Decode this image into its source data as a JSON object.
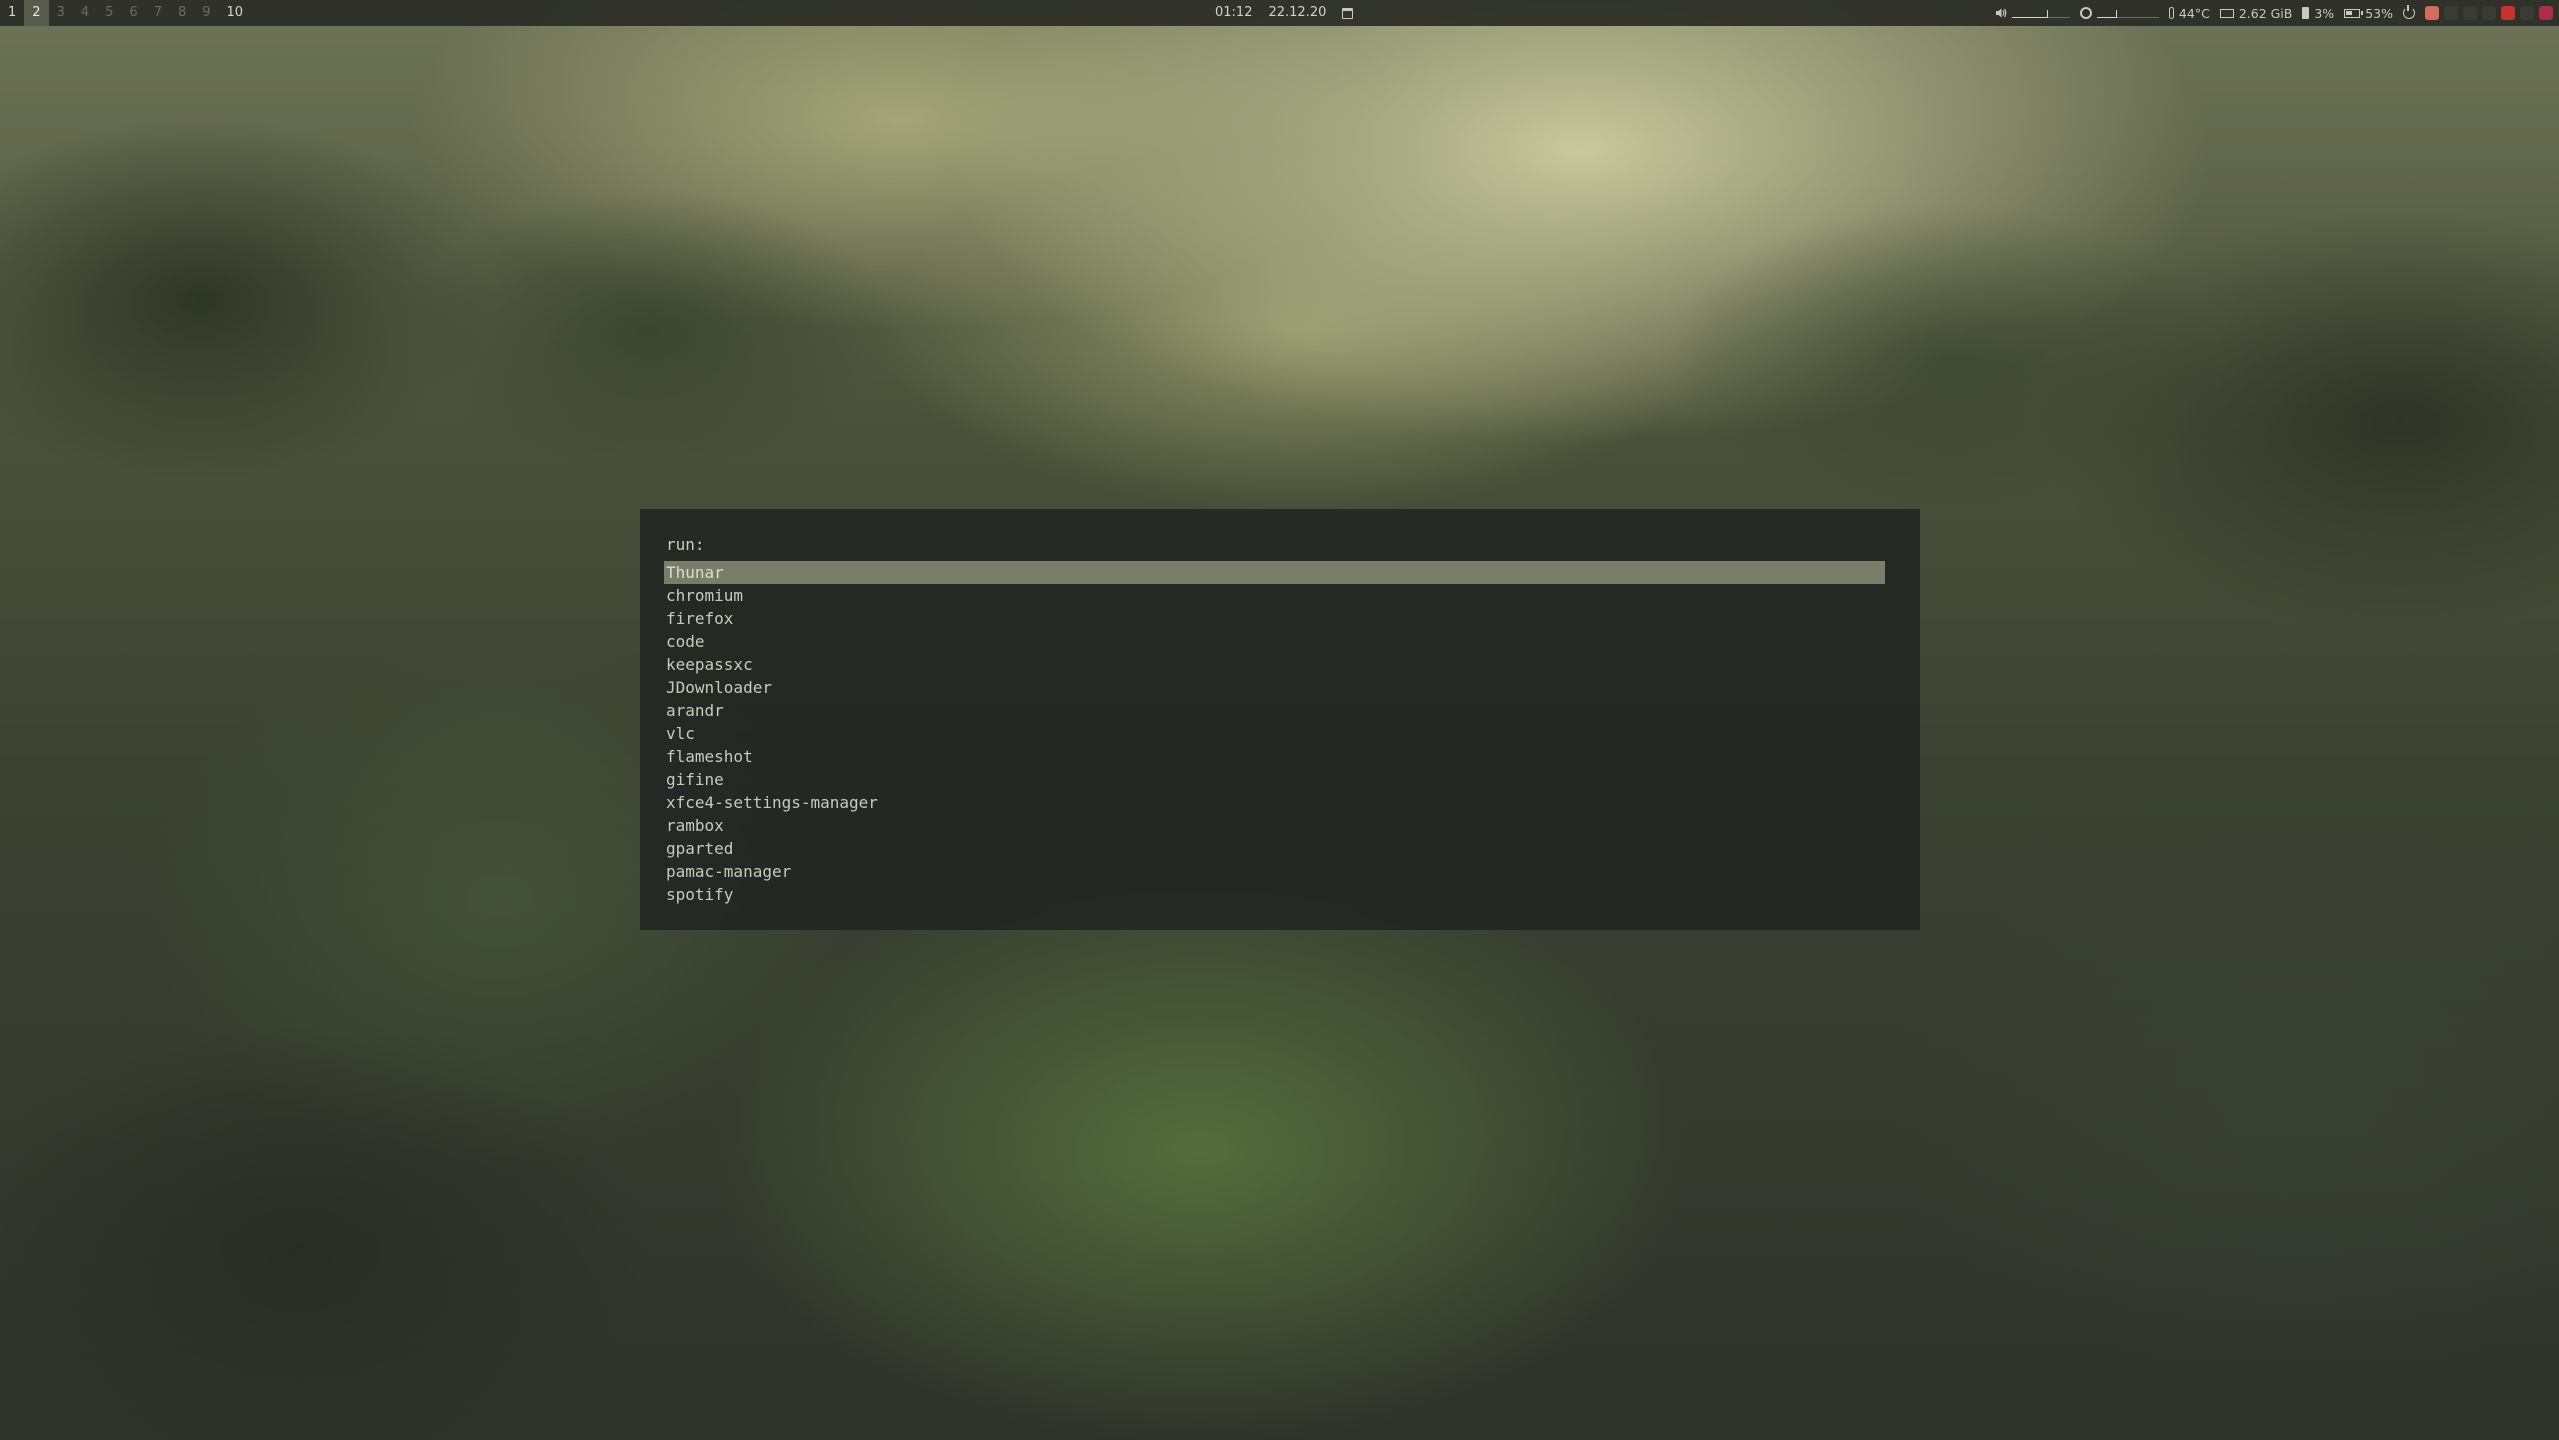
{
  "topbar": {
    "workspaces": [
      {
        "label": "1",
        "state": "occupied"
      },
      {
        "label": "2",
        "state": "focused"
      },
      {
        "label": "3",
        "state": "empty"
      },
      {
        "label": "4",
        "state": "empty"
      },
      {
        "label": "5",
        "state": "empty"
      },
      {
        "label": "6",
        "state": "empty"
      },
      {
        "label": "7",
        "state": "empty"
      },
      {
        "label": "8",
        "state": "empty"
      },
      {
        "label": "9",
        "state": "empty"
      },
      {
        "label": "10",
        "state": "occupied"
      }
    ],
    "time": "01:12",
    "date": "22.12.20",
    "volume_level": 0.6,
    "brightness_level": 0.3,
    "temperature": "44°C",
    "memory": "2.62 GiB",
    "cpu": "3%",
    "battery": "53%",
    "battery_level": 0.53,
    "tray_icons": [
      {
        "name": "tray-app-icon-1",
        "color": "#d46a5a"
      },
      {
        "name": "tray-app-icon-2",
        "color": "#3a3b35"
      },
      {
        "name": "tray-app-icon-3",
        "color": "#3a3b35"
      },
      {
        "name": "tray-app-icon-4",
        "color": "#3a3b35"
      },
      {
        "name": "tray-shield-icon",
        "color": "#c8322d"
      },
      {
        "name": "tray-app-icon-5",
        "color": "#3a3b35"
      },
      {
        "name": "tray-app-icon-6",
        "color": "#b02a4a"
      }
    ]
  },
  "launcher": {
    "prompt": "run:",
    "query": "",
    "selected_index": 0,
    "items": [
      "Thunar",
      "chromium",
      "firefox",
      "code",
      "keepassxc",
      "JDownloader",
      "arandr",
      "vlc",
      "flameshot",
      "gifine",
      "xfce4-settings-manager",
      "rambox",
      "gparted",
      "pamac-manager",
      "spotify"
    ]
  }
}
